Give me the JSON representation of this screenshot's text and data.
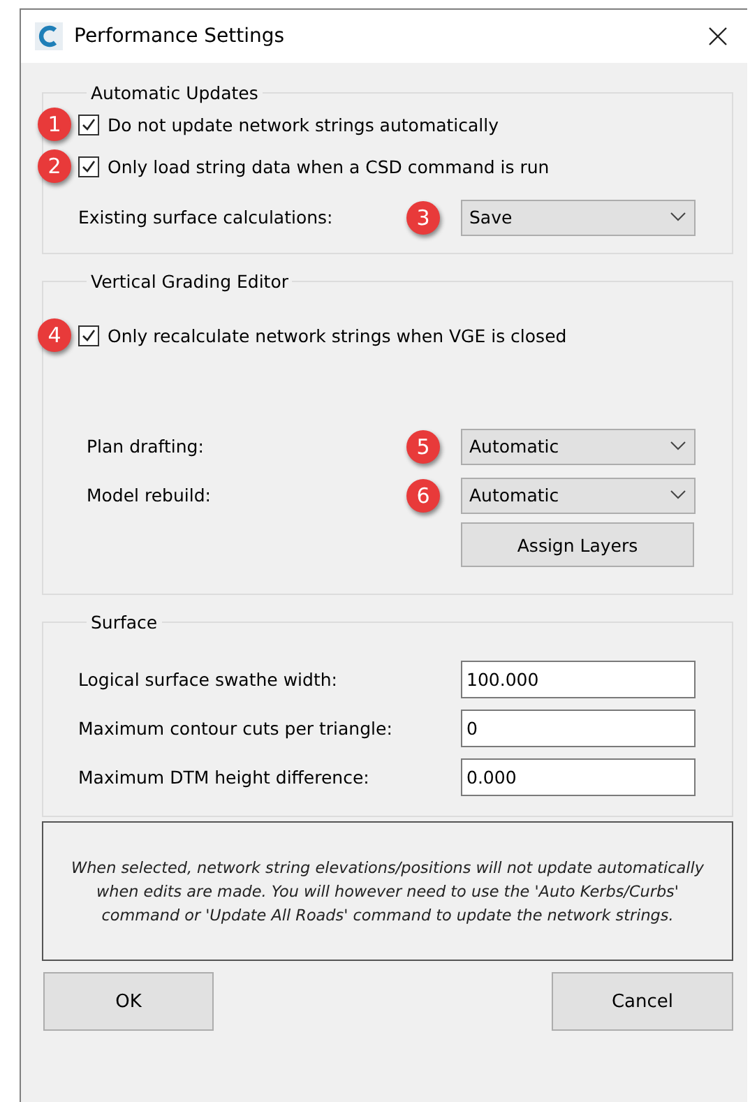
{
  "window": {
    "title": "Performance Settings"
  },
  "groups": [
    {
      "title": "Automatic Updates",
      "items": [
        {
          "kind": "checkbox",
          "badge": "1",
          "label": "Do not update network strings automatically",
          "checked": true
        },
        {
          "kind": "checkbox",
          "badge": "2",
          "label": "Only load string data when a CSD command is run",
          "checked": true
        },
        {
          "kind": "dropdown",
          "badge": "3",
          "label": "Existing surface calculations:",
          "value": "Save"
        }
      ]
    },
    {
      "title": "Vertical Grading Editor",
      "items": [
        {
          "kind": "checkbox",
          "badge": "4",
          "label": "Only recalculate network strings when VGE is closed",
          "checked": true
        },
        {
          "kind": "dropdown",
          "badge": "5",
          "label": "Plan drafting:",
          "value": "Automatic"
        },
        {
          "kind": "dropdown",
          "badge": "6",
          "label": "Model rebuild:",
          "value": "Automatic"
        },
        {
          "kind": "button",
          "label": "Assign Layers"
        }
      ]
    },
    {
      "title": "Surface",
      "items": [
        {
          "kind": "field",
          "label": "Logical surface swathe width:",
          "value": "100.000"
        },
        {
          "kind": "field",
          "label": "Maximum contour cuts per triangle:",
          "value": "0"
        },
        {
          "kind": "field",
          "label": "Maximum DTM height difference:",
          "value": "0.000"
        }
      ]
    }
  ],
  "note": "When selected, network string elevations/positions will not update automatically when edits are made.  You will however need to use the 'Auto Kerbs/Curbs' command or 'Update All Roads' command to update the network strings.",
  "buttons": [
    "OK",
    "Cancel"
  ]
}
